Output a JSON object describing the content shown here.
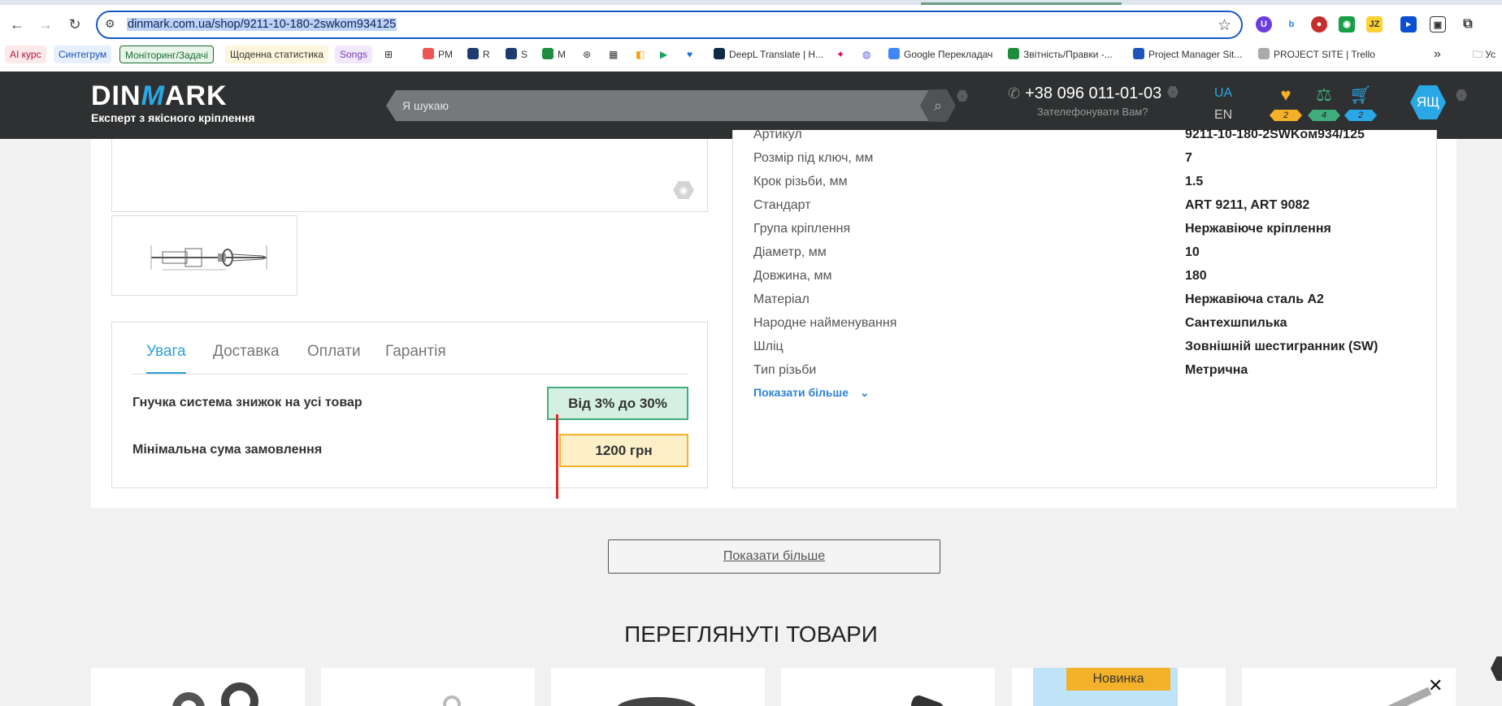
{
  "browser": {
    "url": "dinmark.com.ua/shop/9211-10-180-2swkom934125",
    "bookmarks": [
      "AI курс",
      "Синтегрум",
      "Моніторинг/Задачі",
      "Щоденна статистика",
      "Songs",
      "PM",
      "R",
      "S",
      "M",
      "DeepL Translate | H...",
      "Google Перекладач",
      "Звітність/Правки -...",
      "Project Manager Sit...",
      "PROJECT SITE | Trello",
      "Ус"
    ],
    "bookmarks_more": "»"
  },
  "header": {
    "logo": "DINMARK",
    "logo_left": "DIN",
    "logo_m": "M",
    "logo_right": "ARK",
    "tagline": "Експерт з якісного кріплення",
    "search_placeholder": "Я шукаю",
    "phone": "+38 096 011-01-03",
    "callback": "Зателефонувати Вам?",
    "lang_active": "UA",
    "lang_other": "EN",
    "favorites_count": "2",
    "compare_count": "4",
    "cart_count": "2",
    "avatar": "ЯЩ"
  },
  "tabs": [
    "Увага",
    "Доставка",
    "Оплати",
    "Гарантія"
  ],
  "info": {
    "discount_label": "Гнучка система знижок на усі товар",
    "discount_value": "Від 3% до 30%",
    "min_label": "Мінімальна сума замовлення",
    "min_value": "1200 грн"
  },
  "specs": [
    {
      "k": "Артикул",
      "v": "9211-10-180-2SWKoм934/125"
    },
    {
      "k": "Розмір під ключ, мм",
      "v": "7"
    },
    {
      "k": "Крок різьби, мм",
      "v": "1.5"
    },
    {
      "k": "Стандарт",
      "v": "ART 9211, ART 9082"
    },
    {
      "k": "Група кріплення",
      "v": "Нержавіюче кріплення"
    },
    {
      "k": "Діаметр, мм",
      "v": "10"
    },
    {
      "k": "Довжина, мм",
      "v": "180"
    },
    {
      "k": "Матеріал",
      "v": "Нержавіюча сталь А2"
    },
    {
      "k": "Народне найменування",
      "v": "Сантехшпилька"
    },
    {
      "k": "Шліц",
      "v": "Зовнішній шестигранник (SW)"
    },
    {
      "k": "Тип різьби",
      "v": "Метрична"
    }
  ],
  "show_more_link": "Показати більше",
  "show_more_button": "Показати більше",
  "viewed_title": "ПЕРЕГЛЯНУТІ ТОВАРИ",
  "new_badge": "Новинка",
  "colors": {
    "accent": "#2aa8e6",
    "header": "#2e3031",
    "discount_bg": "#d5f0e3",
    "min_bg": "#fdf0c8"
  }
}
